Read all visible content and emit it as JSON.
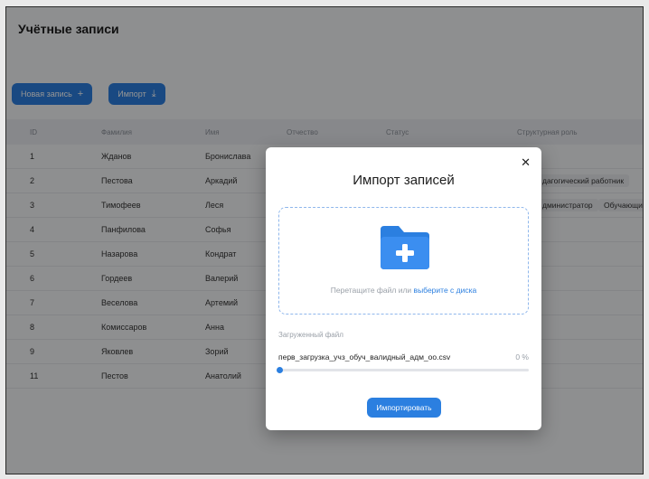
{
  "page": {
    "title": "Учётные записи"
  },
  "toolbar": {
    "new_label": "Новая запись",
    "import_label": "Импорт"
  },
  "table": {
    "headers": [
      "ID",
      "Фамилия",
      "Имя",
      "Отчество",
      "Статус",
      "Структурная роль"
    ],
    "rows": [
      {
        "id": "1",
        "surname": "Жданов",
        "name": "Бронислава"
      },
      {
        "id": "2",
        "surname": "Пестова",
        "name": "Аркадий"
      },
      {
        "id": "3",
        "surname": "Тимофеев",
        "name": "Леся"
      },
      {
        "id": "4",
        "surname": "Панфилова",
        "name": "Софья"
      },
      {
        "id": "5",
        "surname": "Назарова",
        "name": "Кондрат"
      },
      {
        "id": "6",
        "surname": "Гордеев",
        "name": "Валерий"
      },
      {
        "id": "7",
        "surname": "Веселова",
        "name": "Артемий"
      },
      {
        "id": "8",
        "surname": "Комиссаров",
        "name": "Анна"
      },
      {
        "id": "9",
        "surname": "Яковлев",
        "name": "Зорий"
      },
      {
        "id": "11",
        "surname": "Пестов",
        "name": "Анатолий"
      }
    ],
    "role_chips": {
      "row2": "дагогический работник",
      "row3a": "дминистратор",
      "row3b": "Обучающийс"
    }
  },
  "modal": {
    "title": "Импорт записей",
    "drop_text": "Перетащите файл или",
    "drop_link": "выберите с диска",
    "uploaded_label": "Загруженный файл",
    "file_name": "перв_загрузка_учз_обуч_валидный_адм_оо.csv",
    "progress_text": "0 %",
    "progress_value": 0,
    "import_button": "Импортировать"
  },
  "colors": {
    "accent": "#2b7fe0"
  }
}
